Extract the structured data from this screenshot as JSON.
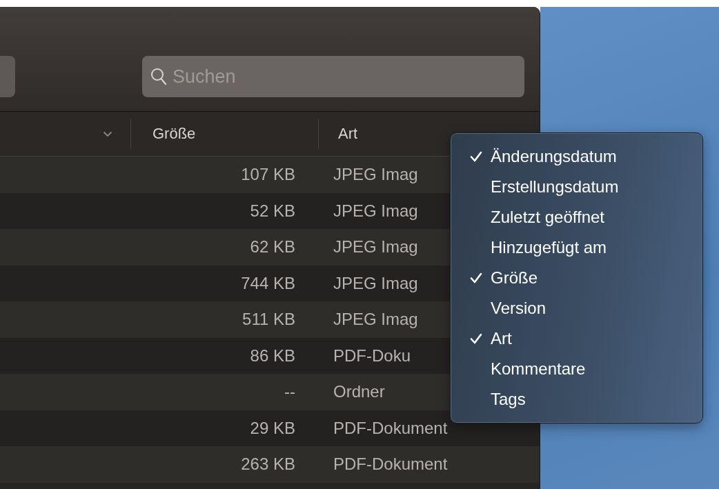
{
  "toolbar": {
    "search": {
      "placeholder": "Suchen"
    }
  },
  "table": {
    "columns": [
      {
        "label": "Größe"
      },
      {
        "label": "Art"
      }
    ],
    "rows": [
      {
        "size": "107 KB",
        "kind": "JPEG Imag"
      },
      {
        "size": "52 KB",
        "kind": "JPEG Imag"
      },
      {
        "size": "62 KB",
        "kind": "JPEG Imag"
      },
      {
        "size": "744 KB",
        "kind": "JPEG Imag"
      },
      {
        "size": "511 KB",
        "kind": "JPEG Imag"
      },
      {
        "size": "86 KB",
        "kind": "PDF-Doku"
      },
      {
        "size": "--",
        "kind": "Ordner"
      },
      {
        "size": "29 KB",
        "kind": "PDF-Dokument"
      },
      {
        "size": "263 KB",
        "kind": "PDF-Dokument"
      }
    ]
  },
  "column_menu": {
    "items": [
      {
        "label": "Änderungsdatum",
        "checked": true
      },
      {
        "label": "Erstellungsdatum",
        "checked": false
      },
      {
        "label": "Zuletzt geöffnet",
        "checked": false
      },
      {
        "label": "Hinzugefügt am",
        "checked": false
      },
      {
        "label": "Größe",
        "checked": true
      },
      {
        "label": "Version",
        "checked": false
      },
      {
        "label": "Art",
        "checked": true
      },
      {
        "label": "Kommentare",
        "checked": false
      },
      {
        "label": "Tags",
        "checked": false
      }
    ]
  }
}
